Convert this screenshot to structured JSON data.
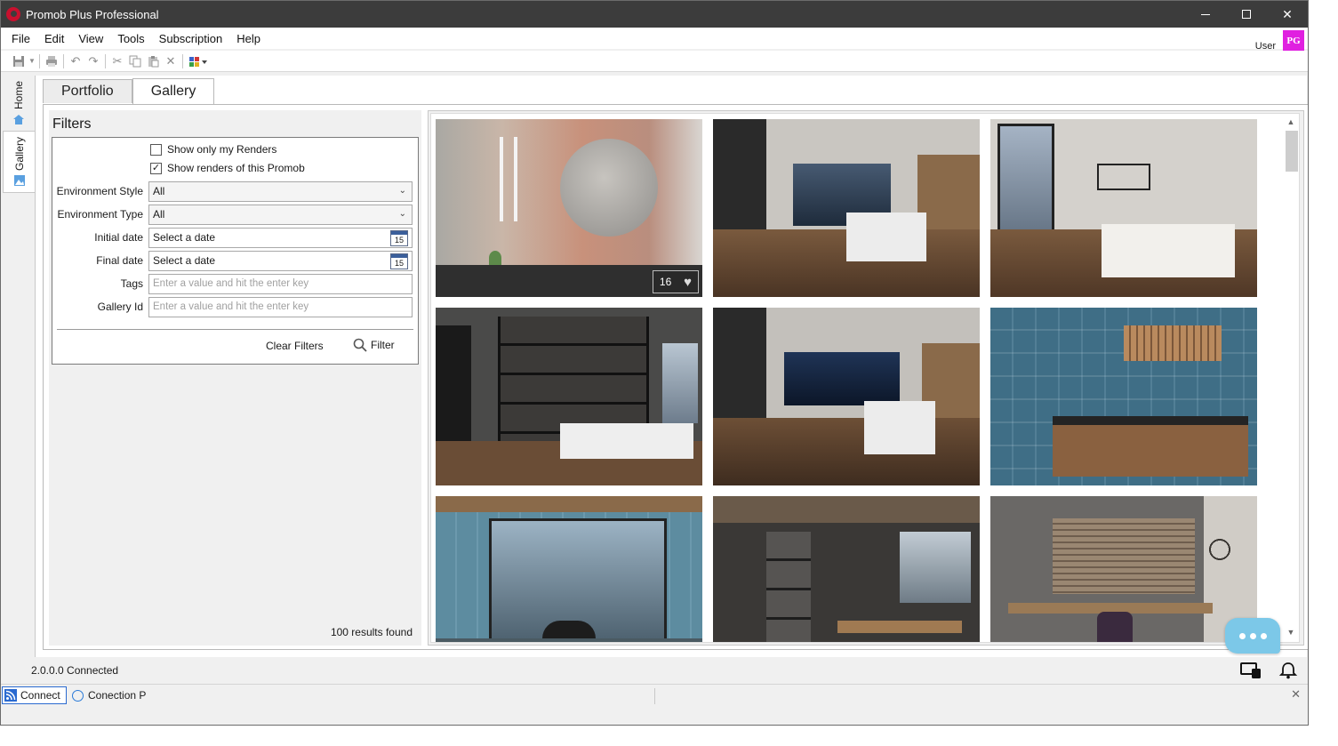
{
  "window": {
    "title": "Promob Plus Professional"
  },
  "menu": [
    "File",
    "Edit",
    "View",
    "Tools",
    "Subscription",
    "Help"
  ],
  "user": {
    "label": "User",
    "initials": "PG"
  },
  "sidetabs": {
    "home": "Home",
    "gallery": "Gallery"
  },
  "tabs": [
    {
      "label": "Portfolio",
      "active": false
    },
    {
      "label": "Gallery",
      "active": true
    }
  ],
  "filters": {
    "title": "Filters",
    "show_only_mine": {
      "label": "Show only my Renders",
      "checked": false
    },
    "show_this_promob": {
      "label": "Show renders of this Promob",
      "checked": true,
      "check_glyph": "✓"
    },
    "environment_style": {
      "label": "Environment Style",
      "value": "All"
    },
    "environment_type": {
      "label": "Environment Type",
      "value": "All"
    },
    "initial_date": {
      "label": "Initial date",
      "value": "Select a date",
      "cal_day": "15"
    },
    "final_date": {
      "label": "Final date",
      "value": "Select a date",
      "cal_day": "15"
    },
    "tags": {
      "label": "Tags",
      "placeholder": "Enter a value and hit the enter key"
    },
    "gallery_id": {
      "label": "Gallery Id",
      "placeholder": "Enter a value and hit the enter key"
    },
    "clear_label": "Clear Filters",
    "filter_label": "Filter",
    "results": "100 results found"
  },
  "gallery": {
    "items": [
      {
        "kind": "bathroom-copper",
        "likes": "16"
      },
      {
        "kind": "kitchen-dark"
      },
      {
        "kind": "kitchen-white"
      },
      {
        "kind": "dining-shelves"
      },
      {
        "kind": "kitchen-dark-night"
      },
      {
        "kind": "bathroom-blue"
      },
      {
        "kind": "bathroom-tiles"
      },
      {
        "kind": "office-dark"
      },
      {
        "kind": "office-wood"
      }
    ]
  },
  "status": {
    "text": "2.0.0.0  Connected"
  },
  "bottom": {
    "connect": "Connect",
    "connection": "Conection P"
  }
}
